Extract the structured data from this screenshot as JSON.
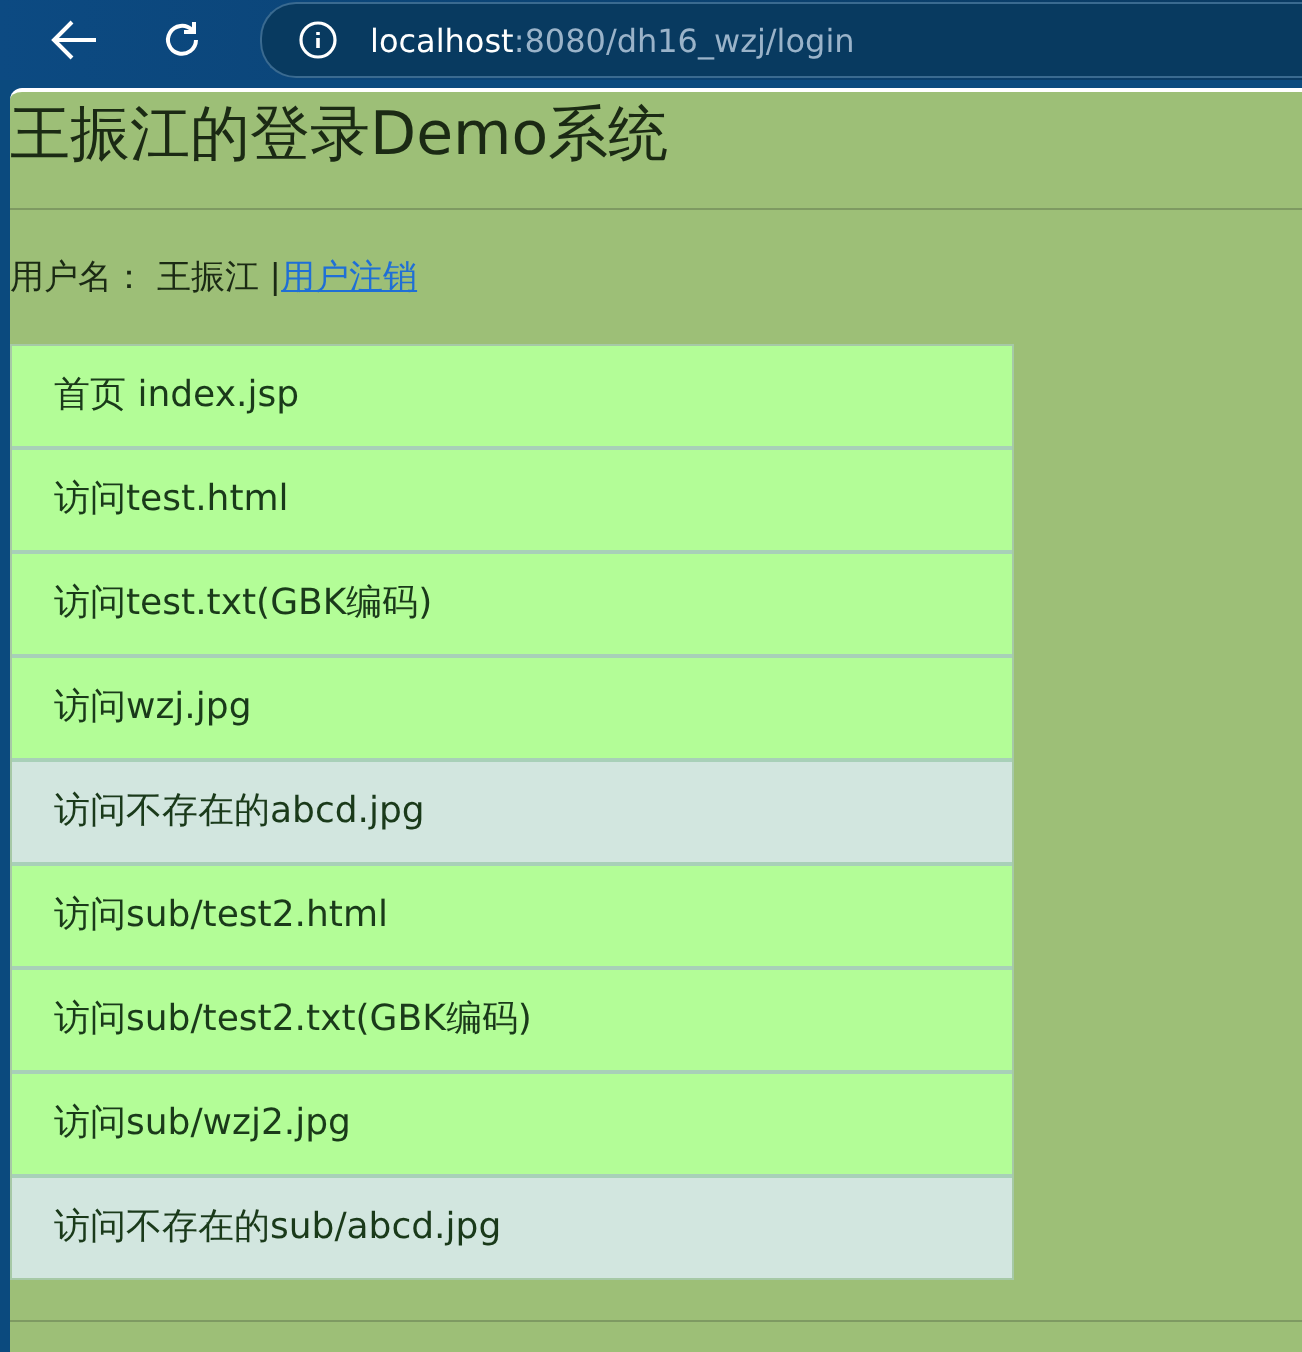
{
  "browser": {
    "host": "localhost",
    "path": ":8080/dh16_wzj/login"
  },
  "title": "王振江的登录Demo系统",
  "user": {
    "label": "用户名： 王振江 |",
    "logout": "用户注销"
  },
  "links": [
    {
      "text": "首页 index.jsp",
      "kind": "ok"
    },
    {
      "text": "访问test.html",
      "kind": "ok"
    },
    {
      "text": "访问test.txt(GBK编码)",
      "kind": "ok"
    },
    {
      "text": "访问wzj.jpg",
      "kind": "ok"
    },
    {
      "text": "访问不存在的abcd.jpg",
      "kind": "missing"
    },
    {
      "text": "访问sub/test2.html",
      "kind": "ok"
    },
    {
      "text": "访问sub/test2.txt(GBK编码)",
      "kind": "ok"
    },
    {
      "text": "访问sub/wzj2.jpg",
      "kind": "ok"
    },
    {
      "text": "访问不存在的sub/abcd.jpg",
      "kind": "missing"
    }
  ]
}
